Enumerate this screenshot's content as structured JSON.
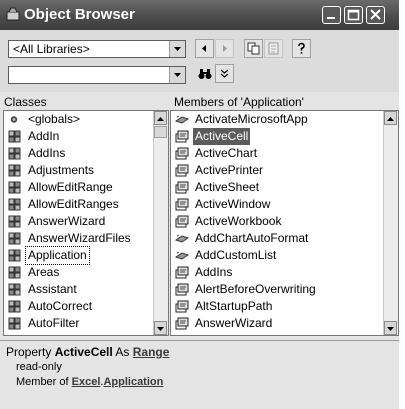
{
  "window": {
    "title": "Object Browser"
  },
  "toolbar": {
    "library_combo": "<All Libraries>",
    "search_combo": "",
    "icons": [
      "back-icon",
      "forward-icon",
      "copy-icon",
      "view-definition-icon",
      "help-icon",
      "binoculars-icon",
      "expand-icon"
    ]
  },
  "classes": {
    "header": "Classes",
    "items": [
      {
        "label": "<globals>",
        "icon": "globals-icon"
      },
      {
        "label": "AddIn",
        "icon": "class-icon"
      },
      {
        "label": "AddIns",
        "icon": "class-icon"
      },
      {
        "label": "Adjustments",
        "icon": "class-icon"
      },
      {
        "label": "AllowEditRange",
        "icon": "class-icon"
      },
      {
        "label": "AllowEditRanges",
        "icon": "class-icon"
      },
      {
        "label": "AnswerWizard",
        "icon": "class-icon"
      },
      {
        "label": "AnswerWizardFiles",
        "icon": "class-icon"
      },
      {
        "label": "Application",
        "icon": "class-icon"
      },
      {
        "label": "Areas",
        "icon": "class-icon"
      },
      {
        "label": "Assistant",
        "icon": "class-icon"
      },
      {
        "label": "AutoCorrect",
        "icon": "class-icon"
      },
      {
        "label": "AutoFilter",
        "icon": "class-icon"
      }
    ]
  },
  "members": {
    "header": "Members of 'Application'",
    "items": [
      {
        "label": "ActivateMicrosoftApp",
        "icon": "method-icon"
      },
      {
        "label": "ActiveCell",
        "icon": "property-icon"
      },
      {
        "label": "ActiveChart",
        "icon": "property-icon"
      },
      {
        "label": "ActivePrinter",
        "icon": "property-icon"
      },
      {
        "label": "ActiveSheet",
        "icon": "property-icon"
      },
      {
        "label": "ActiveWindow",
        "icon": "property-icon"
      },
      {
        "label": "ActiveWorkbook",
        "icon": "property-icon"
      },
      {
        "label": "AddChartAutoFormat",
        "icon": "method-icon"
      },
      {
        "label": "AddCustomList",
        "icon": "method-icon"
      },
      {
        "label": "AddIns",
        "icon": "property-icon"
      },
      {
        "label": "AlertBeforeOverwriting",
        "icon": "property-icon"
      },
      {
        "label": "AltStartupPath",
        "icon": "property-icon"
      },
      {
        "label": "AnswerWizard",
        "icon": "property-icon"
      }
    ]
  },
  "detail": {
    "prefix": "Property ",
    "member": "ActiveCell",
    "as_word": " As ",
    "type": "Range",
    "access": "read-only",
    "member_of": "Member of ",
    "library": "Excel",
    "dot": ".",
    "class": "Application"
  },
  "colors": {
    "selection": "#5c5c5c",
    "titlebar": "#4a4a4a"
  }
}
